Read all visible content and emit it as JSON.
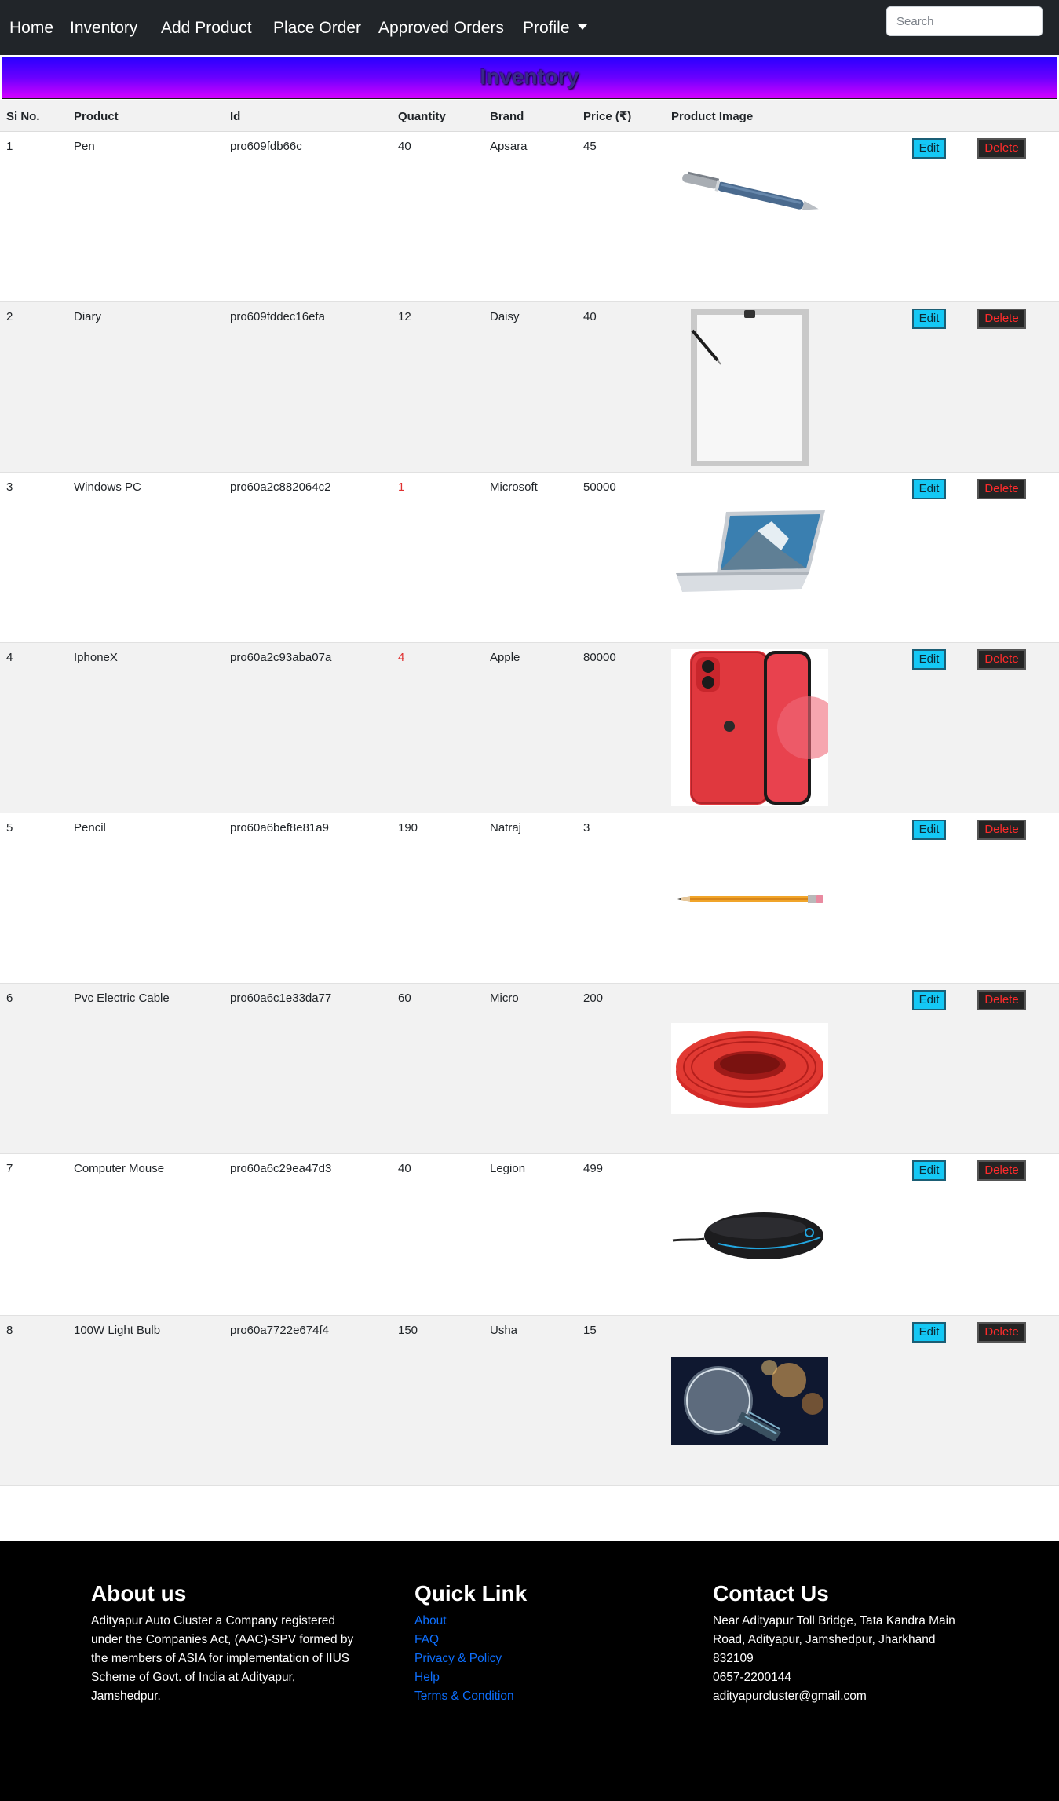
{
  "nav": {
    "items": [
      {
        "label": "Home"
      },
      {
        "label": "Inventory"
      },
      {
        "label": "Add Product"
      },
      {
        "label": "Place Order"
      },
      {
        "label": "Approved Orders"
      },
      {
        "label": "Profile"
      }
    ],
    "search_placeholder": "Search"
  },
  "page_title": "Inventory",
  "table": {
    "headers": [
      "Si No.",
      "Product",
      "Id",
      "Quantity",
      "Brand",
      "Price (₹)",
      "Product Image"
    ],
    "rows": [
      {
        "si": "1",
        "product": "Pen",
        "id": "pro609fdb66c",
        "quantity": "40",
        "brand": "Apsara",
        "price": "45",
        "image": "pen-image"
      },
      {
        "si": "2",
        "product": "Diary",
        "id": "pro609fddec16efa",
        "quantity": "12",
        "brand": "Daisy",
        "price": "40",
        "image": "paper-sheet-image"
      },
      {
        "si": "3",
        "product": "Windows PC",
        "id": "pro60a2c882064c2",
        "quantity": "1",
        "brand": "Microsoft",
        "price": "50000",
        "image": "laptop-image"
      },
      {
        "si": "4",
        "product": "IphoneX",
        "id": "pro60a2c93aba07a",
        "quantity": "4",
        "brand": "Apple",
        "price": "80000",
        "image": "red-iphone-image"
      },
      {
        "si": "5",
        "product": "Pencil",
        "id": "pro60a6bef8e81a9",
        "quantity": "190",
        "brand": "Natraj",
        "price": "3",
        "image": "pencil-image"
      },
      {
        "si": "6",
        "product": "Pvc Electric Cable",
        "id": "pro60a6c1e33da77",
        "quantity": "60",
        "brand": "Micro",
        "price": "200",
        "image": "red-cable-coil-image"
      },
      {
        "si": "7",
        "product": "Computer Mouse",
        "id": "pro60a6c29ea47d3",
        "quantity": "40",
        "brand": "Legion",
        "price": "499",
        "image": "computer-mouse-image"
      },
      {
        "si": "8",
        "product": "100W Light Bulb",
        "id": "pro60a7722e674f4",
        "quantity": "150",
        "brand": "Usha",
        "price": "15",
        "image": "light-bulb-image"
      }
    ],
    "edit_label": "Edit",
    "delete_label": "Delete",
    "low_stock_color": "#e03131"
  },
  "footer": {
    "about": {
      "title": "About us",
      "text": "Adityapur Auto Cluster a Company registered under the Companies Act, (AAC)-SPV formed by the members of ASIA for implementation of IIUS Scheme of Govt. of India at Adityapur, Jamshedpur."
    },
    "quick_links": {
      "title": "Quick Link",
      "links": [
        "About",
        "FAQ",
        "Privacy & Policy",
        "Help",
        "Terms & Condition"
      ]
    },
    "contact": {
      "title": "Contact Us",
      "address": "Near Adityapur Toll Bridge, Tata Kandra Main Road, Adityapur, Jamshedpur, Jharkhand 832109",
      "phone": "0657-2200144",
      "email": "adityapurcluster@gmail.com"
    }
  },
  "colors": {
    "navbar": "#212529",
    "edit_button": "#14c8f5",
    "delete_button": "#242424",
    "delete_text": "#ff2b2b",
    "footer": "#000000",
    "link": "#0d6efd"
  }
}
